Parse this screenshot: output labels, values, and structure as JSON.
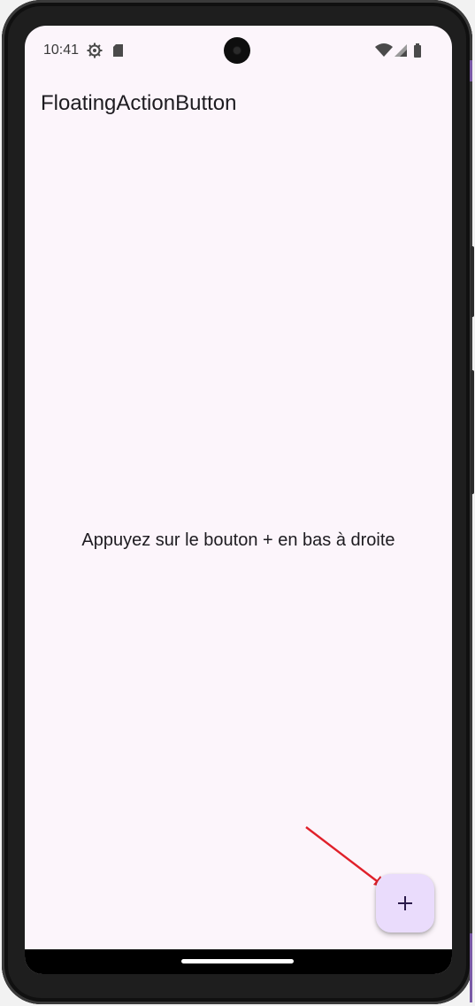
{
  "status_bar": {
    "time": "10:41",
    "left_icons": [
      "settings-gear-icon",
      "sd-card-icon"
    ],
    "right_icons": [
      "wifi-icon",
      "cell-signal-icon",
      "battery-icon"
    ]
  },
  "app": {
    "title": "FloatingActionButton",
    "body_text": "Appuyez sur le bouton + en bas à droite"
  },
  "fab": {
    "icon": "plus-icon"
  },
  "annotation": {
    "arrow_color": "#e0202a"
  },
  "colors": {
    "background": "#fcf5fb",
    "fab_container": "#eadcfc",
    "fab_icon": "#2a1a4a",
    "text": "#1d1b20"
  }
}
